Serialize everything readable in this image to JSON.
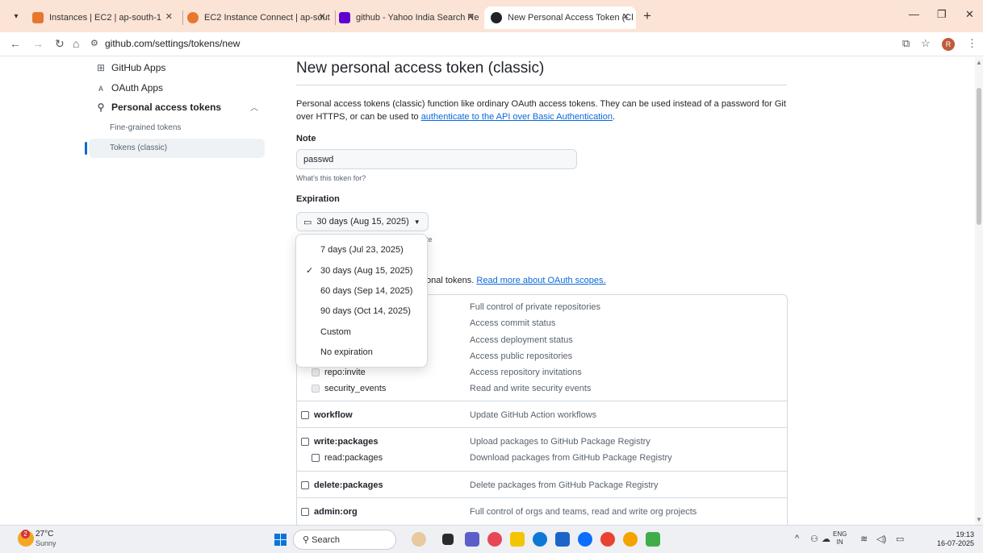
{
  "browser": {
    "tabs": [
      {
        "title": "Instances | EC2 | ap-south-1",
        "favicon_color": "#e8772e"
      },
      {
        "title": "EC2 Instance Connect | ap-sout",
        "favicon_color": "#e8772e"
      },
      {
        "title": "github - Yahoo India Search Re",
        "favicon_color": "#6001d2"
      },
      {
        "title": "New Personal Access Token (Cl",
        "favicon_color": "#1f2328"
      }
    ],
    "url": "github.com/settings/tokens/new",
    "profile_initial": "R"
  },
  "sidebar": {
    "items": [
      {
        "label": "GitHub Apps",
        "icon": "grid-icon"
      },
      {
        "label": "OAuth Apps",
        "icon": "person-icon"
      },
      {
        "label": "Personal access tokens",
        "icon": "key-icon"
      }
    ],
    "subitems": [
      "Fine-grained tokens",
      "Tokens (classic)"
    ]
  },
  "main": {
    "title": "New personal access token (classic)",
    "description_text": "Personal access tokens (classic) function like ordinary OAuth access tokens. They can be used instead of a password for Git over HTTPS, or can be used to ",
    "description_link": "authenticate to the API over Basic Authentication",
    "description_end": ".",
    "note_label": "Note",
    "note_value": "passwd",
    "note_hint": "What's this token for?",
    "expiration_label": "Expiration",
    "expiration_value": "30 days (Aug 15, 2025)",
    "behind_partial_1": "te",
    "behind_partial_2": "onal tokens.",
    "oauth_scopes_link": "Read more about OAuth scopes."
  },
  "dropdown": {
    "options": [
      {
        "label": "7 days (Jul 23, 2025)",
        "selected": false
      },
      {
        "label": "30 days (Aug 15, 2025)",
        "selected": true
      },
      {
        "label": "60 days (Sep 14, 2025)",
        "selected": false
      },
      {
        "label": "90 days (Oct 14, 2025)",
        "selected": false
      },
      {
        "label": "Custom",
        "selected": false
      },
      {
        "label": "No expiration",
        "selected": false
      }
    ]
  },
  "scopes": {
    "repo_descriptions": [
      "Full control of private repositories",
      "Access commit status",
      "Access deployment status",
      "Access public repositories"
    ],
    "repo_invite": {
      "name": "repo:invite",
      "desc": "Access repository invitations"
    },
    "security_events": {
      "name": "security_events",
      "desc": "Read and write security events"
    },
    "workflow": {
      "name": "workflow",
      "desc": "Update GitHub Action workflows"
    },
    "write_packages": {
      "name": "write:packages",
      "desc": "Upload packages to GitHub Package Registry"
    },
    "read_packages": {
      "name": "read:packages",
      "desc": "Download packages from GitHub Package Registry"
    },
    "delete_packages": {
      "name": "delete:packages",
      "desc": "Delete packages from GitHub Package Registry"
    },
    "admin_org": {
      "name": "admin:org",
      "desc": "Full control of orgs and teams, read and write org projects"
    }
  },
  "taskbar": {
    "weather_temp": "27°C",
    "weather_cond": "Sunny",
    "weather_badge": "2",
    "search_label": "Search",
    "lang_1": "ENG",
    "lang_2": "IN",
    "time": "19:13",
    "date": "16-07-2025"
  }
}
